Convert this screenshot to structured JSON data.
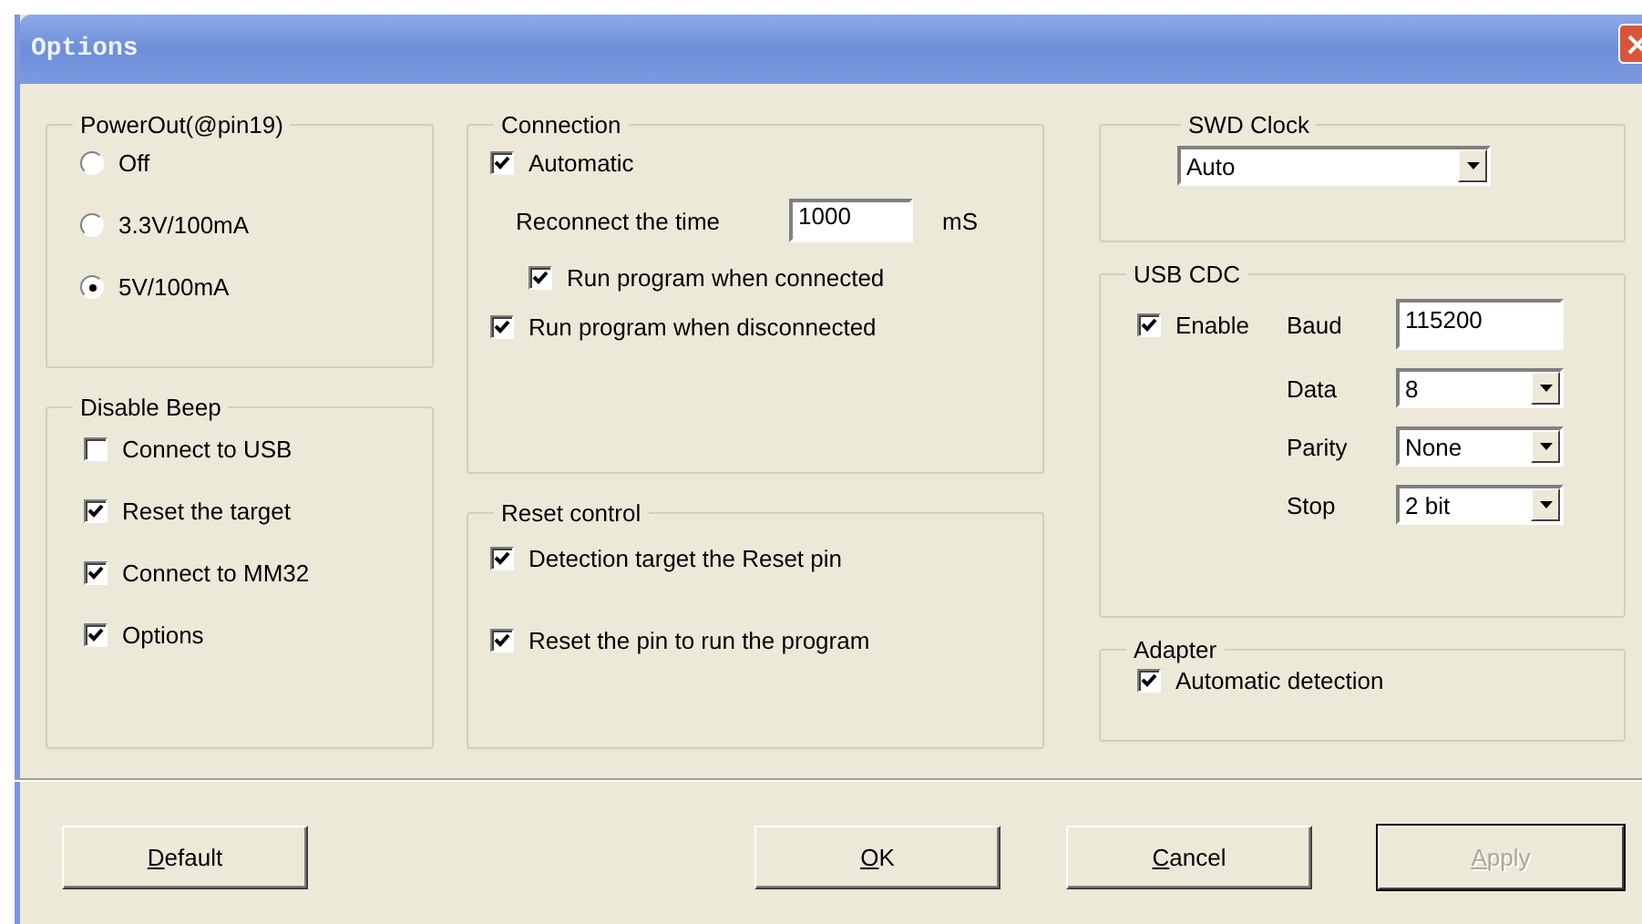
{
  "window": {
    "title": "Options"
  },
  "power_out": {
    "label": "PowerOut(@pin19)",
    "options": [
      {
        "label": "Off",
        "selected": false
      },
      {
        "label": "3.3V/100mA",
        "selected": false
      },
      {
        "label": "5V/100mA",
        "selected": true
      }
    ]
  },
  "disable_beep": {
    "label": "Disable Beep",
    "items": [
      {
        "label": "Connect to USB",
        "checked": false
      },
      {
        "label": "Reset the target",
        "checked": true
      },
      {
        "label": "Connect to MM32",
        "checked": true
      },
      {
        "label": "Options",
        "checked": true
      }
    ]
  },
  "connection": {
    "label": "Connection",
    "automatic": {
      "label": "Automatic",
      "checked": true
    },
    "reconnect": {
      "label": "Reconnect the time",
      "value": "1000",
      "unit": "mS"
    },
    "run_connected": {
      "label": "Run program when connected",
      "checked": true
    },
    "run_disconnected": {
      "label": "Run program when disconnected",
      "checked": true
    }
  },
  "reset_control": {
    "label": "Reset control",
    "items": [
      {
        "label": "Detection target the Reset pin",
        "checked": true
      },
      {
        "label": "Reset the pin to run the program",
        "checked": true
      }
    ]
  },
  "swd_clock": {
    "label": "SWD Clock",
    "value": "Auto"
  },
  "usb_cdc": {
    "label": "USB CDC",
    "enable": {
      "label": "Enable",
      "checked": true
    },
    "fields": [
      {
        "kind": "input",
        "label": "Baud",
        "value": "115200"
      },
      {
        "kind": "select",
        "label": "Data",
        "value": "8"
      },
      {
        "kind": "select",
        "label": "Parity",
        "value": "None"
      },
      {
        "kind": "select",
        "label": "Stop",
        "value": "2 bit"
      }
    ]
  },
  "adapter": {
    "label": "Adapter",
    "items": [
      {
        "label": "Automatic detection",
        "checked": true
      }
    ]
  },
  "buttons": [
    {
      "label": "Default",
      "underline_first": true,
      "disabled": false,
      "default": false
    },
    {
      "label": "OK",
      "underline_first": true,
      "disabled": false,
      "default": false
    },
    {
      "label": "Cancel",
      "underline_first": true,
      "disabled": false,
      "default": false
    },
    {
      "label": "Apply",
      "underline_first": true,
      "disabled": true,
      "default": true
    }
  ]
}
